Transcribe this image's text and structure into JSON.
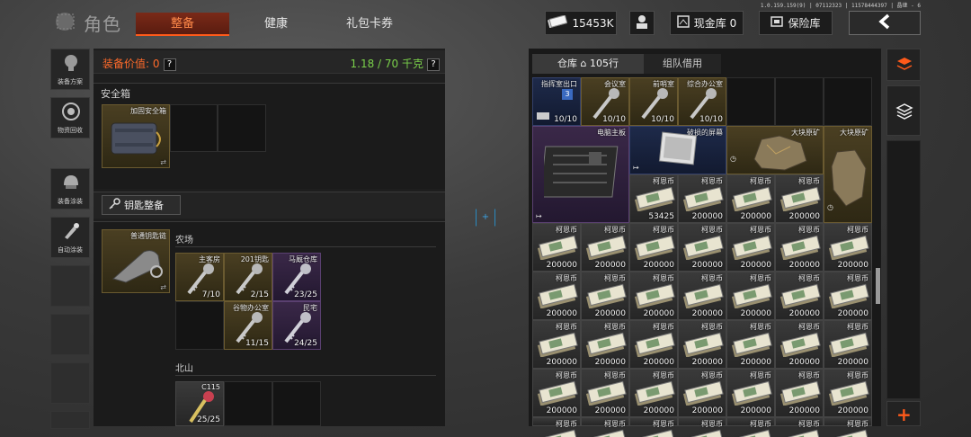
{
  "topbar": {
    "title": "角色",
    "tabs": [
      "整备",
      "健康",
      "礼包卡券"
    ],
    "active_tab": 0,
    "version": "1.0.159.159(9) | 07112323 | 11578444397 | 晶继 - 6",
    "currency": "15453K",
    "cash_vault": "现金库 0",
    "safe": "保险库"
  },
  "sidebar": {
    "items": [
      "装备方案",
      "物资回收",
      "装备涂装",
      "自动涂装"
    ]
  },
  "equipment": {
    "value_label": "装备价值: 0",
    "weight": "1.18 / 70 千克",
    "safe_box_title": "安全箱",
    "safe_box_item": "加固安全箱",
    "key_button": "钥匙整备",
    "keychain_item": "普通钥匙链",
    "farm_title": "农场",
    "farm_keys": [
      {
        "name": "主客房",
        "count": "7/10",
        "rarity": "gold"
      },
      {
        "name": "201钥匙",
        "count": "2/15",
        "rarity": "gold"
      },
      {
        "name": "马厩仓库",
        "count": "23/25",
        "rarity": "purple"
      },
      {
        "name": "谷物办公室",
        "count": "11/15",
        "rarity": "gold"
      },
      {
        "name": "民宅",
        "count": "24/25",
        "rarity": "purple"
      }
    ],
    "north_title": "北山",
    "north_keys": [
      {
        "name": "C115",
        "count": "25/25",
        "rarity": "gray"
      }
    ]
  },
  "warehouse": {
    "tab_storage": "仓库",
    "row_count": "105行",
    "tab_team": "组队借用",
    "top_items": [
      {
        "name": "指挥室出口",
        "count": "10/10",
        "badge": "3"
      },
      {
        "name": "会议室",
        "count": "10/10"
      },
      {
        "name": "前哨室",
        "count": "10/10"
      },
      {
        "name": "综合办公室",
        "count": "10/10"
      }
    ],
    "big_items": [
      {
        "name": "电脑主板"
      },
      {
        "name": "破损的屏幕"
      },
      {
        "name": "大块原矿"
      },
      {
        "name": "大块原矿"
      }
    ],
    "money_name": "柯恩币",
    "money_first_row": [
      "53425",
      "200000",
      "200000",
      "200000"
    ],
    "money_full": "200000"
  },
  "colors": {
    "accent": "#ff5a1a",
    "weight_green": "#7ad04a"
  }
}
